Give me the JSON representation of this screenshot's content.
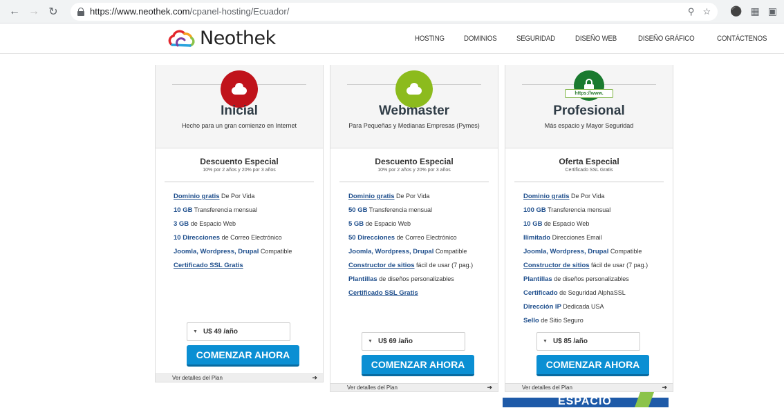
{
  "browser": {
    "url_host": "https://www.neothek.com",
    "url_path": "/cpanel-hosting/Ecuador/"
  },
  "site": {
    "logo_text": "Neothek",
    "nav": [
      "HOSTING",
      "DOMINIOS",
      "SEGURIDAD",
      "DISEÑO WEB",
      "DISEÑO GRÁFICO",
      "CONTÁCTENOS"
    ]
  },
  "colors": {
    "inicial": "#c0131b",
    "webmaster": "#8cbb1d",
    "profesional": "#1a7a2f",
    "cta": "#0b8fd3",
    "link": "#1e4e8c"
  },
  "plans": [
    {
      "name": "Inicial",
      "tagline": "Hecho para un gran comienzo en Internet",
      "icon": "cloud-icon",
      "offer_title": "Descuento Especial",
      "offer_sub": "10% por 2 años y 20% por 3 años",
      "features": [
        {
          "hl": "Dominio gratis",
          "text": " De Por Vida",
          "u": true
        },
        {
          "hl": "10 GB",
          "text": " Transferencia mensual"
        },
        {
          "hl": "3 GB",
          "text": " de Espacio Web"
        },
        {
          "hl": "10 Direcciones",
          "text": " de Correo Electrónico"
        },
        {
          "hl": "Joomla, Wordpress, Drupal",
          "text": " Compatible"
        },
        {
          "hl": "Certificado SSL Gratis",
          "text": "",
          "u": true
        }
      ],
      "price": "U$ 49 /año",
      "cta": "COMENZAR AHORA",
      "details": "Ver detalles del Plan"
    },
    {
      "name": "Webmaster",
      "tagline": "Para Pequeñas y Medianas Empresas (Pymes)",
      "icon": "cloud-icon",
      "offer_title": "Descuento Especial",
      "offer_sub": "10% por 2 años y 20% por 3 años",
      "features": [
        {
          "hl": "Dominio gratis",
          "text": " De Por Vida",
          "u": true
        },
        {
          "hl": "50 GB",
          "text": " Transferencia mensual"
        },
        {
          "hl": "5 GB",
          "text": " de Espacio Web"
        },
        {
          "hl": "50 Direcciones",
          "text": " de Correo Electrónico"
        },
        {
          "hl": "Joomla, Wordpress, Drupal",
          "text": " Compatible"
        },
        {
          "hl": "Constructor de sitios",
          "text": " fácil de usar (7 pag.)",
          "u": true
        },
        {
          "hl": "Plantillas",
          "text": " de diseños personalizables"
        },
        {
          "hl": "Certificado SSL Gratis",
          "text": "",
          "u": true
        }
      ],
      "price": "U$ 69 /año",
      "cta": "COMENZAR AHORA",
      "details": "Ver detalles del Plan"
    },
    {
      "name": "Profesional",
      "tagline": "Más espacio y Mayor Seguridad",
      "icon": "padlock-icon",
      "ssl_badge": "https://www.",
      "offer_title": "Oferta Especial",
      "offer_sub": "Certificado SSL Gratis",
      "features": [
        {
          "hl": "Dominio gratis",
          "text": " De Por Vida",
          "u": true
        },
        {
          "hl": "100 GB",
          "text": " Transferencia mensual"
        },
        {
          "hl": "10 GB",
          "text": " de Espacio Web"
        },
        {
          "hl": "Ilimitado",
          "text": " Direcciones Email"
        },
        {
          "hl": "Joomla, Wordpress, Drupal",
          "text": " Compatible"
        },
        {
          "hl": "Constructor de sitios",
          "text": " fácil de usar (7 pag.)",
          "u": true
        },
        {
          "hl": "Plantillas",
          "text": " de diseños personalizables"
        },
        {
          "hl": "Certificado",
          "text": " de Seguridad AlphaSSL"
        },
        {
          "hl": "Dirección IP",
          "text": " Dedicada USA"
        },
        {
          "hl": "Sello",
          "text": " de Sitio Seguro"
        }
      ],
      "price": "U$ 85 /año",
      "cta": "COMENZAR AHORA",
      "details": "Ver detalles del Plan"
    }
  ],
  "banner_text": "ESPACIO"
}
